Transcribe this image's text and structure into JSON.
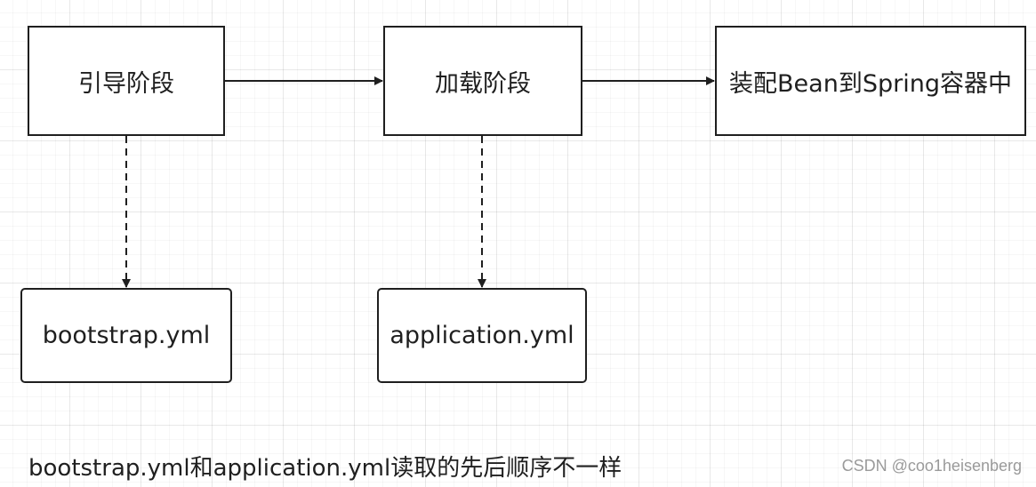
{
  "diagram": {
    "nodes": {
      "bootstrap_phase": {
        "label": "引导阶段"
      },
      "loading_phase": {
        "label": "加载阶段"
      },
      "assemble_bean": {
        "label": "装配Bean到Spring容器中"
      },
      "bootstrap_yml": {
        "label": "bootstrap.yml"
      },
      "application_yml": {
        "label": "application.yml"
      }
    },
    "edges": [
      {
        "from": "bootstrap_phase",
        "to": "loading_phase",
        "style": "solid"
      },
      {
        "from": "loading_phase",
        "to": "assemble_bean",
        "style": "solid"
      },
      {
        "from": "bootstrap_phase",
        "to": "bootstrap_yml",
        "style": "dashed"
      },
      {
        "from": "loading_phase",
        "to": "application_yml",
        "style": "dashed"
      }
    ],
    "caption": "bootstrap.yml和application.yml读取的先后顺序不一样"
  },
  "watermark": "CSDN @coo1heisenberg",
  "colors": {
    "stroke": "#1f1f1f",
    "background": "#ffffff",
    "watermark": "#9a9a9a"
  }
}
